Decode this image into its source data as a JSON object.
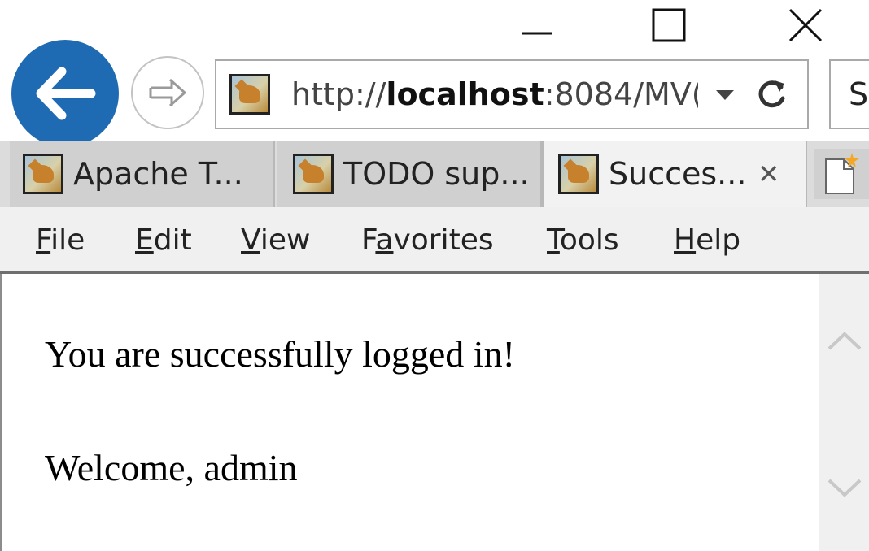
{
  "window": {
    "minimize_icon": "minimize-icon",
    "maximize_icon": "maximize-icon",
    "close_icon": "close-icon"
  },
  "nav": {
    "back_icon": "back-arrow-icon",
    "forward_icon": "forward-arrow-icon",
    "accent_color": "#1f6bb3"
  },
  "address_bar": {
    "url_prefix": "http://",
    "url_host": "localhost",
    "url_suffix": ":8084/MV(",
    "dropdown_icon": "dropdown-triangle-icon",
    "refresh_icon": "refresh-icon"
  },
  "search_box": {
    "visible_text": "S"
  },
  "tabs": [
    {
      "label": "Apache T...",
      "active": false
    },
    {
      "label": "TODO sup...",
      "active": false
    },
    {
      "label": "Succes...",
      "active": true,
      "close": "✕"
    }
  ],
  "new_tab_icon": "new-tab-icon",
  "menu": {
    "items": [
      {
        "label": "File",
        "underline": "F"
      },
      {
        "label": "Edit",
        "underline": "E"
      },
      {
        "label": "View",
        "underline": "V"
      },
      {
        "label": "Favorites",
        "underline": "a"
      },
      {
        "label": "Tools",
        "underline": "T"
      },
      {
        "label": "Help",
        "underline": "H"
      }
    ]
  },
  "content": {
    "line1": "You are successfully logged in!",
    "line2": "Welcome, admin"
  },
  "scrollbar": {
    "up_icon": "scroll-up-chevron-icon",
    "down_icon": "scroll-down-chevron-icon"
  }
}
